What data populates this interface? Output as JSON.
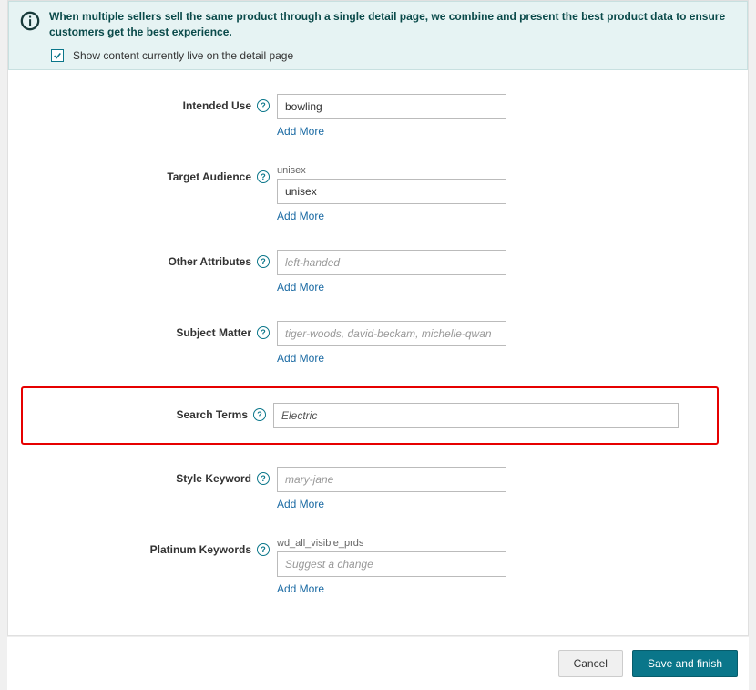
{
  "banner": {
    "text": "When multiple sellers sell the same product through a single detail page, we combine and present the best product data to ensure customers get the best experience.",
    "checkbox_label": "Show content currently live on the detail page",
    "checkbox_checked": true
  },
  "add_more_label": "Add More",
  "fields": {
    "intended_use": {
      "label": "Intended Use",
      "value": "bowling"
    },
    "target_audience": {
      "label": "Target Audience",
      "hint": "unisex",
      "value": "unisex"
    },
    "other_attributes": {
      "label": "Other Attributes",
      "placeholder": "left-handed"
    },
    "subject_matter": {
      "label": "Subject Matter",
      "placeholder": "tiger-woods, david-beckam, michelle-qwan"
    },
    "search_terms": {
      "label": "Search Terms",
      "value": "Electric"
    },
    "style_keyword": {
      "label": "Style Keyword",
      "placeholder": "mary-jane"
    },
    "platinum_keywords": {
      "label": "Platinum Keywords",
      "hint": "wd_all_visible_prds",
      "placeholder": "Suggest a change"
    }
  },
  "footer": {
    "cancel": "Cancel",
    "save": "Save and finish"
  }
}
